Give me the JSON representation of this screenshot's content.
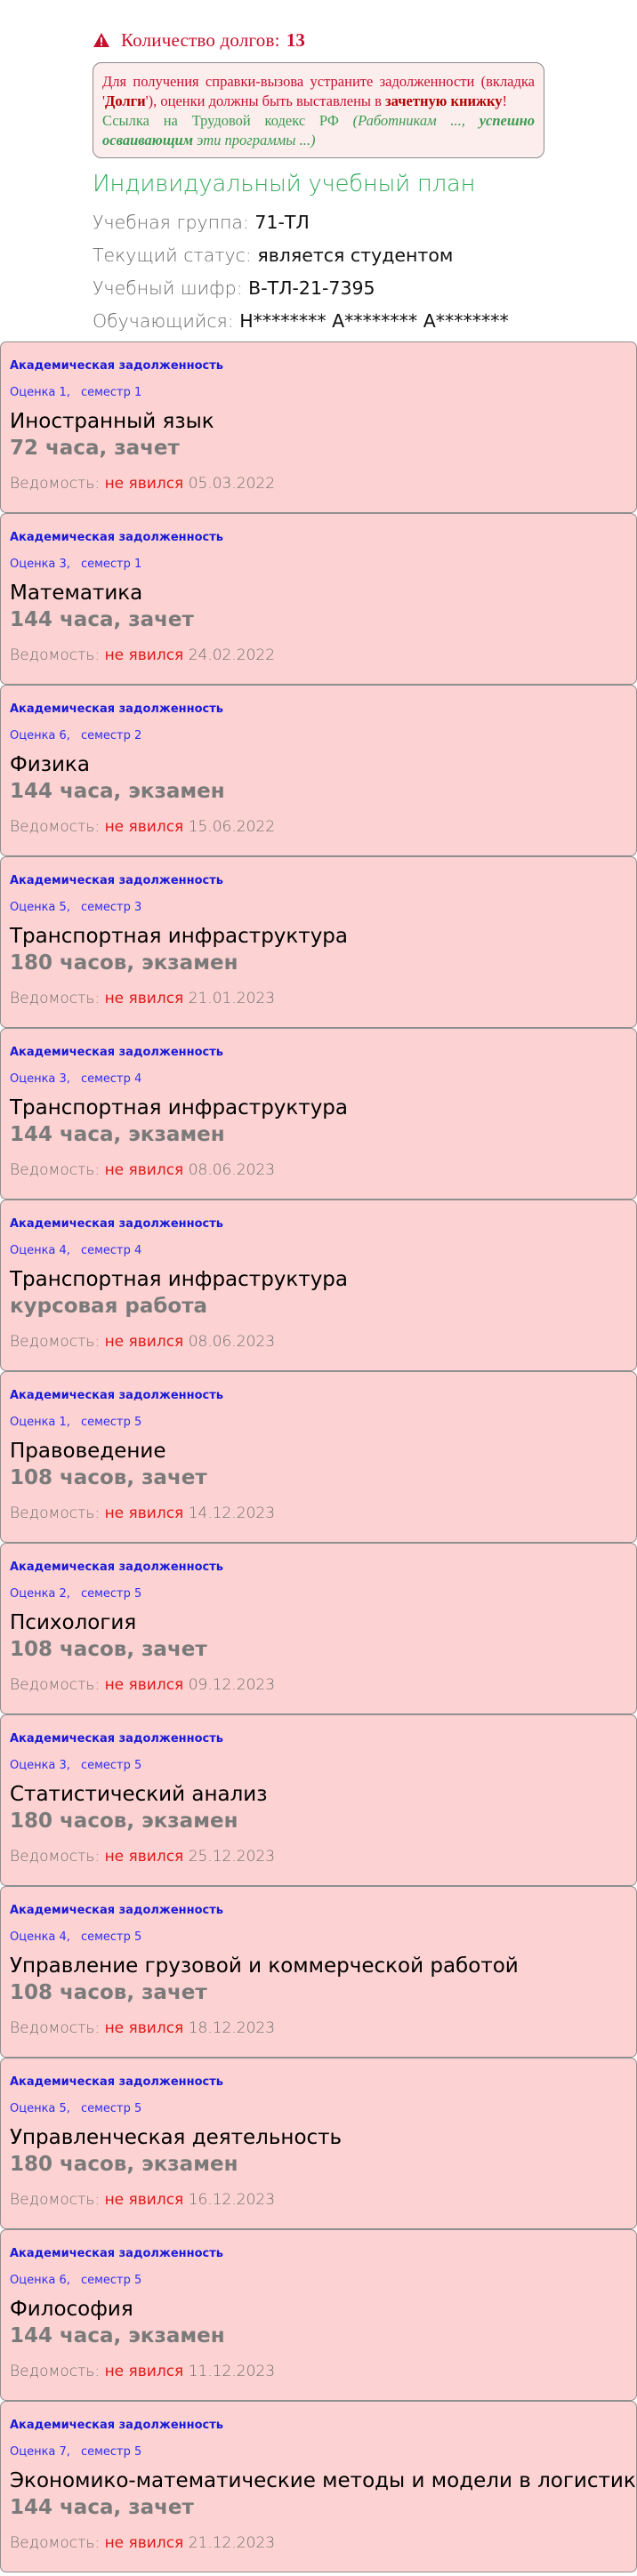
{
  "debts": {
    "label": "Количество долгов:",
    "count": "13",
    "icon": "warning-icon"
  },
  "notice": {
    "line1_pre": "Для получения справки-вызова устраните задолженности (вкладка '",
    "tab_name": "Долги",
    "line1_post": "'), оценки должны быть выставлены в ",
    "record_book": "зачетную книжку",
    "line1_end": "!",
    "link_pre": "Ссылка на Трудовой кодекс РФ ",
    "link_italic": "(Работникам ..., ",
    "link_bold": "успешно осваивающим",
    "link_italic_end": " эти программы ...)"
  },
  "plan": {
    "title": "Индивидуальный учебный план",
    "group_label": "Учебная группа:",
    "group_value": "71-ТЛ",
    "status_label": "Текущий статус:",
    "status_value": "является студентом",
    "cipher_label": "Учебный шифр:",
    "cipher_value": "В-ТЛ-21-7395",
    "student_label": "Обучающийся:",
    "student_value": "Н******** А******** А********"
  },
  "colors": {
    "accent_green": "#38ad5e",
    "card_bg": "#fdd2d2",
    "debt_red": "#c8102e",
    "link_blue": "#1a1ad9"
  },
  "cards": [
    {
      "type": "Академическая задолженность",
      "grade": "Оценка 1,",
      "semester": "семестр 1",
      "subject": "Иностранный язык",
      "hours": "72 часа, зачет",
      "vedomost_label": "Ведомость:",
      "status": "не явился",
      "date": "05.03.2022"
    },
    {
      "type": "Академическая задолженность",
      "grade": "Оценка 3,",
      "semester": "семестр 1",
      "subject": "Математика",
      "hours": "144 часа, зачет",
      "vedomost_label": "Ведомость:",
      "status": "не явился",
      "date": "24.02.2022"
    },
    {
      "type": "Академическая задолженность",
      "grade": "Оценка 6,",
      "semester": "семестр 2",
      "subject": "Физика",
      "hours": "144 часа, экзамен",
      "vedomost_label": "Ведомость:",
      "status": "не явился",
      "date": "15.06.2022"
    },
    {
      "type": "Академическая задолженность",
      "grade": "Оценка 5,",
      "semester": "семестр 3",
      "subject": "Транспортная инфраструктура",
      "hours": "180 часов, экзамен",
      "vedomost_label": "Ведомость:",
      "status": "не явился",
      "date": "21.01.2023"
    },
    {
      "type": "Академическая задолженность",
      "grade": "Оценка 3,",
      "semester": "семестр 4",
      "subject": "Транспортная инфраструктура",
      "hours": "144 часа, экзамен",
      "vedomost_label": "Ведомость:",
      "status": "не явился",
      "date": "08.06.2023"
    },
    {
      "type": "Академическая задолженность",
      "grade": "Оценка 4,",
      "semester": "семестр 4",
      "subject": "Транспортная инфраструктура",
      "hours": "курсовая работа",
      "vedomost_label": "Ведомость:",
      "status": "не явился",
      "date": "08.06.2023"
    },
    {
      "type": "Академическая задолженность",
      "grade": "Оценка 1,",
      "semester": "семестр 5",
      "subject": "Правоведение",
      "hours": "108 часов, зачет",
      "vedomost_label": "Ведомость:",
      "status": "не явился",
      "date": "14.12.2023"
    },
    {
      "type": "Академическая задолженность",
      "grade": "Оценка 2,",
      "semester": "семестр 5",
      "subject": "Психология",
      "hours": "108 часов, зачет",
      "vedomost_label": "Ведомость:",
      "status": "не явился",
      "date": "09.12.2023"
    },
    {
      "type": "Академическая задолженность",
      "grade": "Оценка 3,",
      "semester": "семестр 5",
      "subject": "Статистический анализ",
      "hours": "180 часов, экзамен",
      "vedomost_label": "Ведомость:",
      "status": "не явился",
      "date": "25.12.2023"
    },
    {
      "type": "Академическая задолженность",
      "grade": "Оценка 4,",
      "semester": "семестр 5",
      "subject": "Управление грузовой и коммерческой работой",
      "hours": "108 часов, зачет",
      "vedomost_label": "Ведомость:",
      "status": "не явился",
      "date": "18.12.2023"
    },
    {
      "type": "Академическая задолженность",
      "grade": "Оценка 5,",
      "semester": "семестр 5",
      "subject": "Управленческая деятельность",
      "hours": "180 часов, экзамен",
      "vedomost_label": "Ведомость:",
      "status": "не явился",
      "date": "16.12.2023"
    },
    {
      "type": "Академическая задолженность",
      "grade": "Оценка 6,",
      "semester": "семестр 5",
      "subject": "Философия",
      "hours": "144 часа, экзамен",
      "vedomost_label": "Ведомость:",
      "status": "не явился",
      "date": "11.12.2023"
    },
    {
      "type": "Академическая задолженность",
      "grade": "Оценка 7,",
      "semester": "семестр 5",
      "subject": "Экономико-математические методы и модели в логистике",
      "hours": "144 часа, зачет",
      "vedomost_label": "Ведомость:",
      "status": "не явился",
      "date": "21.12.2023"
    }
  ]
}
